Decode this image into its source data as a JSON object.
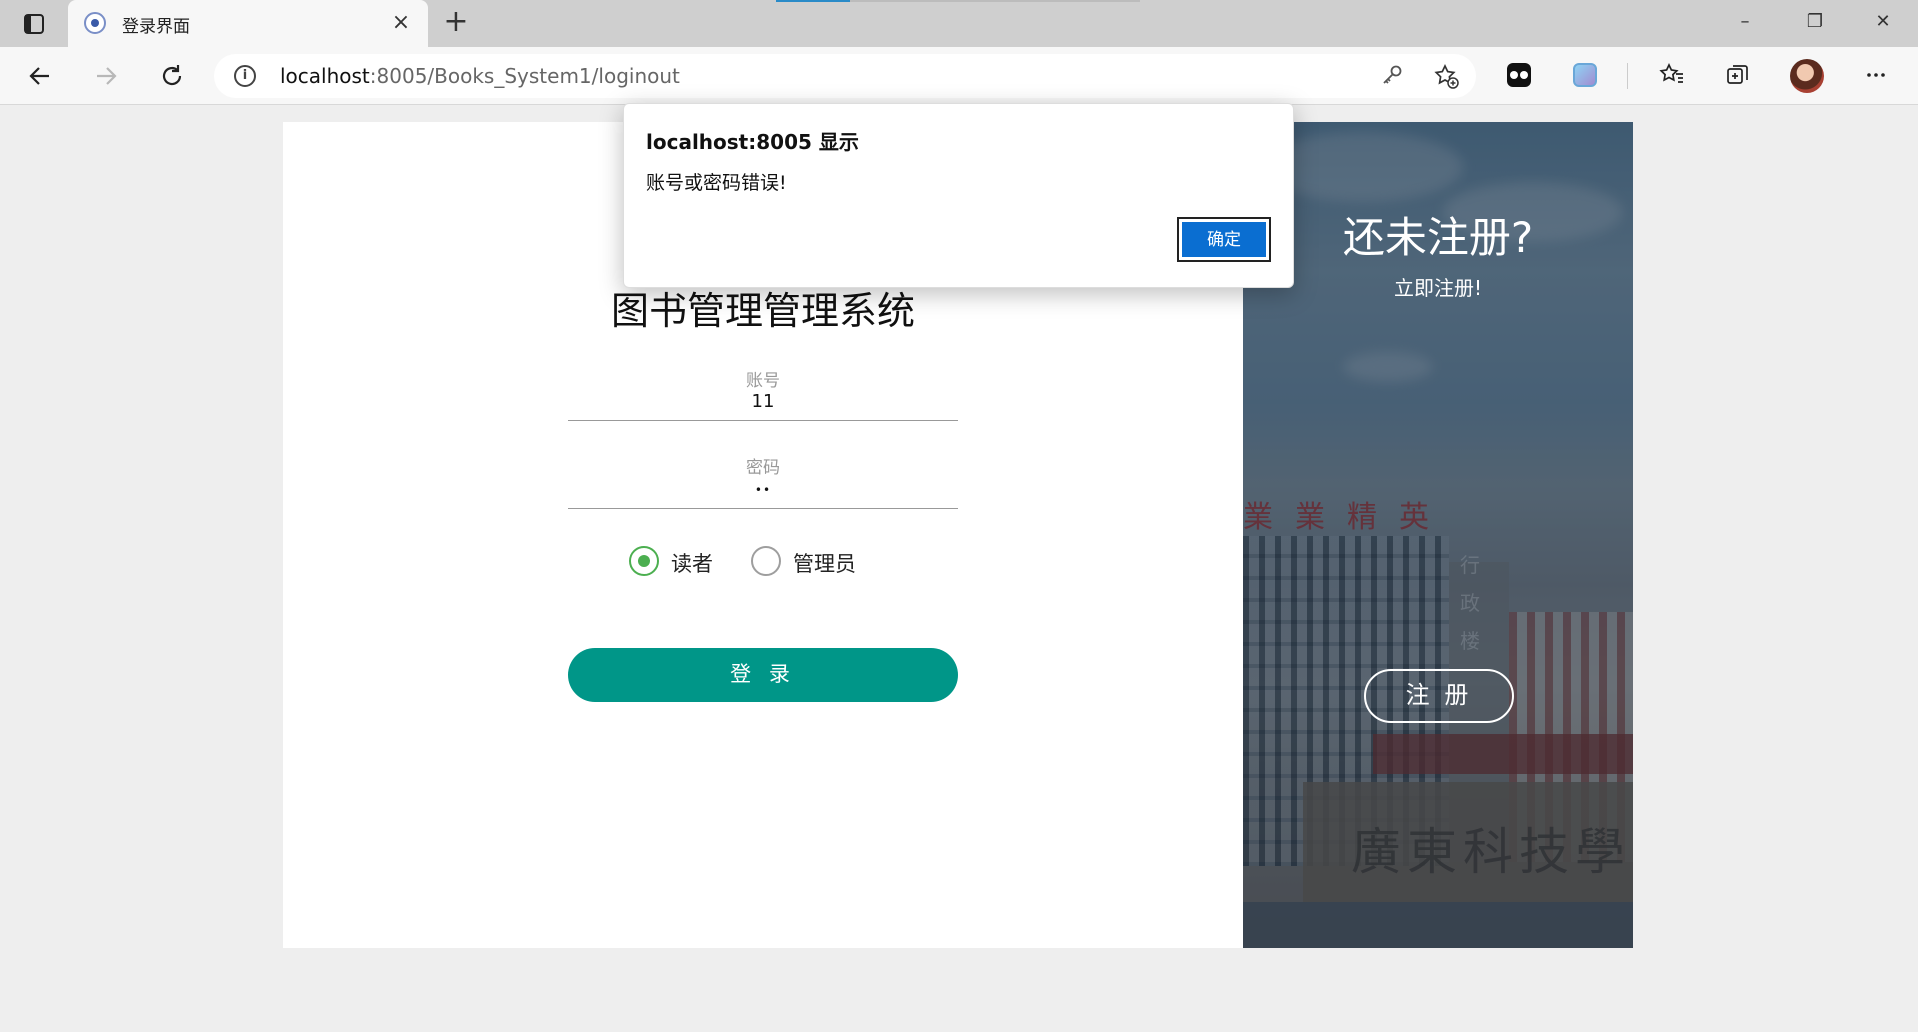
{
  "browser": {
    "tab_title": "登录界面",
    "tab_close": "×",
    "new_tab": "+",
    "url_host": "localhost",
    "url_path": ":8005/Books_System1/loginout",
    "window_controls": {
      "minimize": "–",
      "maximize": "❐",
      "close": "✕"
    },
    "icons": [
      "tab-actions-icon",
      "back-icon",
      "forward-icon",
      "refresh-icon",
      "info-icon",
      "key-icon",
      "add-favorite-icon",
      "favorites-icon",
      "collections-icon",
      "more-icon"
    ]
  },
  "login": {
    "title": "图书管理管理系统",
    "account_label": "账号",
    "account_value": "11",
    "password_label": "密码",
    "password_value": "••",
    "roles": [
      {
        "label": "读者",
        "checked": true
      },
      {
        "label": "管理员",
        "checked": false
      }
    ],
    "login_button": "登 录"
  },
  "register": {
    "title": "还未注册?",
    "subtitle": "立即注册!",
    "button": "注 册"
  },
  "dialog": {
    "title": "localhost:8005 显示",
    "message": "账号或密码错误!",
    "ok": "确定"
  },
  "colors": {
    "primary": "#009688",
    "radio_checked": "#4caf50",
    "dialog_button": "#0a6ed1"
  }
}
